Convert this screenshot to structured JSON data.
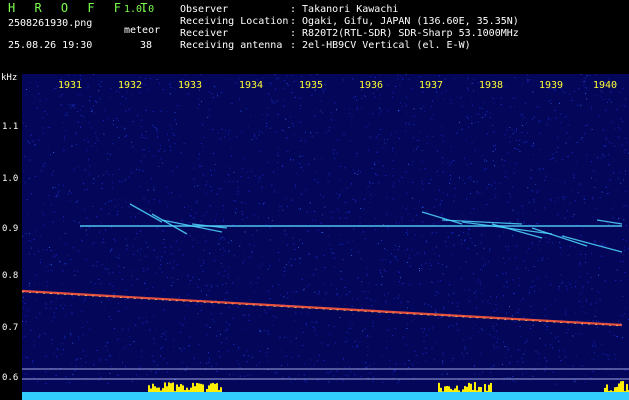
{
  "header": {
    "logo": "H R O F F T",
    "version": "1.0.0",
    "filename": "2508261930.png",
    "mode": "meteor",
    "timestamp": "25.08.26 19:30",
    "count": "38",
    "observer_label": "Observer",
    "observer_value": ": Takanori Kawachi",
    "location_label": "Receiving Location",
    "location_value": ": Ogaki, Gifu, JAPAN (136.60E, 35.35N)",
    "receiver_label": "Receiver",
    "receiver_value": ": R820T2(RTL-SDR) SDR-Sharp 53.1000MHz",
    "antenna_label": "Receiving antenna",
    "antenna_value": ": 2el-HB9CV Vertical (el. E-W)"
  },
  "axes": {
    "y_unit": "kHz",
    "y_ticks": [
      "1.1",
      "1.0",
      "0.9",
      "0.8",
      "0.7",
      "0.6"
    ],
    "x_ticks": [
      "1931",
      "1932",
      "1933",
      "1934",
      "1935",
      "1936",
      "1937",
      "1938",
      "1939",
      "1940"
    ]
  },
  "colors": {
    "background": "#04065a",
    "noise": "#1f3cff",
    "carrier": "#55d9ff",
    "trace": "#ff5a3c",
    "bar": "#ffee00",
    "bar_base": "#33ccff"
  }
}
